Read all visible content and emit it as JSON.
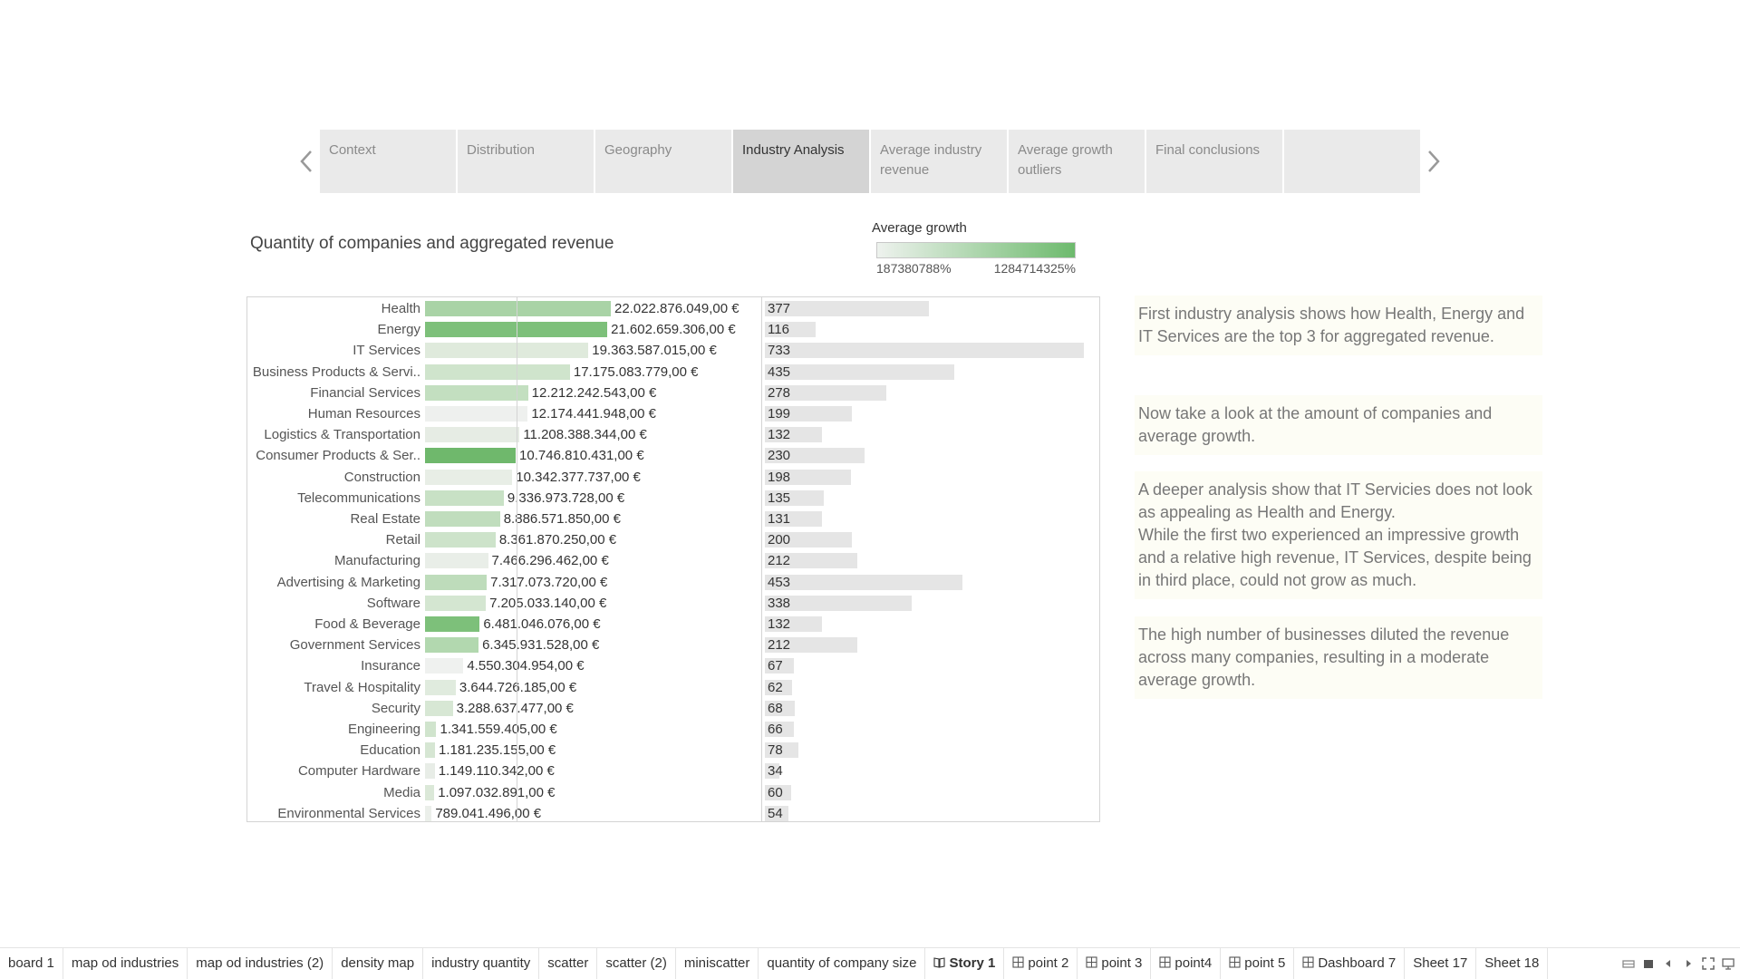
{
  "story": {
    "points": [
      {
        "label": "Context",
        "active": false
      },
      {
        "label": "Distribution",
        "active": false
      },
      {
        "label": "Geography",
        "active": false
      },
      {
        "label": "Industry Analysis",
        "active": true
      },
      {
        "label": "Average industry revenue",
        "active": false
      },
      {
        "label": "Average growth outliers",
        "active": false
      },
      {
        "label": "Final conclusions",
        "active": false
      },
      {
        "label": "",
        "active": false
      }
    ],
    "prev_icon": "chevron-left-icon",
    "next_icon": "chevron-right-icon"
  },
  "chart_title": "Quantity of companies and aggregated revenue",
  "legend": {
    "title": "Average growth",
    "min_label": "187380788%",
    "max_label": "1284714325%",
    "color_low": "#eef2ee",
    "color_high": "#6dba6d"
  },
  "chart_data": {
    "type": "bar",
    "categories": [
      "Health",
      "Energy",
      "IT Services",
      "Business Products & Servi..",
      "Financial Services",
      "Human Resources",
      "Logistics & Transportation",
      "Consumer Products & Ser..",
      "Construction",
      "Telecommunications",
      "Real Estate",
      "Retail",
      "Manufacturing",
      "Advertising & Marketing",
      "Software",
      "Food & Beverage",
      "Government Services",
      "Insurance",
      "Travel & Hospitality",
      "Security",
      "Engineering",
      "Education",
      "Computer Hardware",
      "Media",
      "Environmental Services"
    ],
    "series": [
      {
        "name": "",
        "values": [
          22022876049,
          21602659306,
          19363587015,
          17175083779,
          12212242543,
          12174441948,
          11208388344,
          10746810431,
          10342377737,
          9336973728,
          8886571850,
          8361870250,
          7466296462,
          7317073720,
          7205033140,
          6481046076,
          6345931528,
          4550304954,
          3644726185,
          3288637477,
          1341559405,
          1181235155,
          1149110342,
          1097032891,
          789041496
        ],
        "labels": [
          "22.022.876.049,00 €",
          "21.602.659.306,00 €",
          "19.363.587.015,00 €",
          "17.175.083.779,00 €",
          "12.212.242.543,00 €",
          "12.174.441.948,00 €",
          "11.208.388.344,00 €",
          "10.746.810.431,00 €",
          "10.342.377.737,00 €",
          "9.336.973.728,00 €",
          "8.886.571.850,00 €",
          "8.361.870.250,00 €",
          "7.466.296.462,00 €",
          "7.317.073.720,00 €",
          "7.205.033.140,00 €",
          "6.481.046.076,00 €",
          "6.345.931.528,00 €",
          "4.550.304.954,00 €",
          "3.644.726.185,00 €",
          "3.288.637.477,00 €",
          "1.341.559.405,00 €",
          "1.181.235.155,00 €",
          "1.149.110.342,00 €",
          "1.097.032.891,00 €",
          "789.041.496,00 €"
        ],
        "colors": [
          "#a9d3a6",
          "#7dc07a",
          "#dfeadc",
          "#cfe4cc",
          "#c3dfc0",
          "#eef0ee",
          "#e6ece4",
          "#6fb86c",
          "#e8eee6",
          "#c8e1c5",
          "#c0ddbd",
          "#cde3ca",
          "#e9eee8",
          "#bedcbb",
          "#d4e6d1",
          "#7dc07a",
          "#b2d8af",
          "#eff1ef",
          "#e0ebde",
          "#d7e7d4",
          "#d0e4cd",
          "#d6e6d3",
          "#e8ede7",
          "#dbe8d8",
          "#ebefea"
        ]
      },
      {
        "name": "",
        "values": [
          377,
          116,
          733,
          435,
          278,
          199,
          132,
          230,
          198,
          135,
          131,
          200,
          212,
          453,
          338,
          132,
          212,
          67,
          62,
          68,
          66,
          78,
          34,
          60,
          54
        ]
      }
    ],
    "revenue_max": 22022876049,
    "count_max": 733
  },
  "captions": [
    "First industry analysis shows how Health, Energy and IT Services are the top 3 for aggregated revenue.",
    "Now take a look at the amount of companies and average growth.",
    "A deeper analysis show that IT Servicies does not look as appealing as Health and Energy.\nWhile the first two experienced an impressive growth and a relative high revenue, IT Services, despite being in third place, could not grow as much.",
    "The high number of businesses diluted the revenue across many companies, resulting in a moderate average growth."
  ],
  "tabs": [
    {
      "label": "board 1",
      "icon": "",
      "active": false
    },
    {
      "label": "map od industries",
      "icon": "",
      "active": false
    },
    {
      "label": "map od industries (2)",
      "icon": "",
      "active": false
    },
    {
      "label": "density map",
      "icon": "",
      "active": false
    },
    {
      "label": "industry quantity",
      "icon": "",
      "active": false
    },
    {
      "label": "scatter",
      "icon": "",
      "active": false
    },
    {
      "label": "scatter (2)",
      "icon": "",
      "active": false
    },
    {
      "label": "miniscatter",
      "icon": "",
      "active": false
    },
    {
      "label": "quantity of company size",
      "icon": "",
      "active": false
    },
    {
      "label": "Story 1",
      "icon": "story-icon",
      "active": true
    },
    {
      "label": "point 2",
      "icon": "dashboard-icon",
      "active": false
    },
    {
      "label": "point 3",
      "icon": "dashboard-icon",
      "active": false
    },
    {
      "label": "point4",
      "icon": "dashboard-icon",
      "active": false
    },
    {
      "label": "point 5",
      "icon": "dashboard-icon",
      "active": false
    },
    {
      "label": "Dashboard 7",
      "icon": "dashboard-icon",
      "active": false
    },
    {
      "label": "Sheet 17",
      "icon": "",
      "active": false
    },
    {
      "label": "Sheet 18",
      "icon": "",
      "active": false
    }
  ],
  "controls": [
    "filmstrip-icon",
    "tabs-icon",
    "prev-sheet-icon",
    "next-sheet-icon",
    "fullscreen-icon",
    "present-icon"
  ]
}
